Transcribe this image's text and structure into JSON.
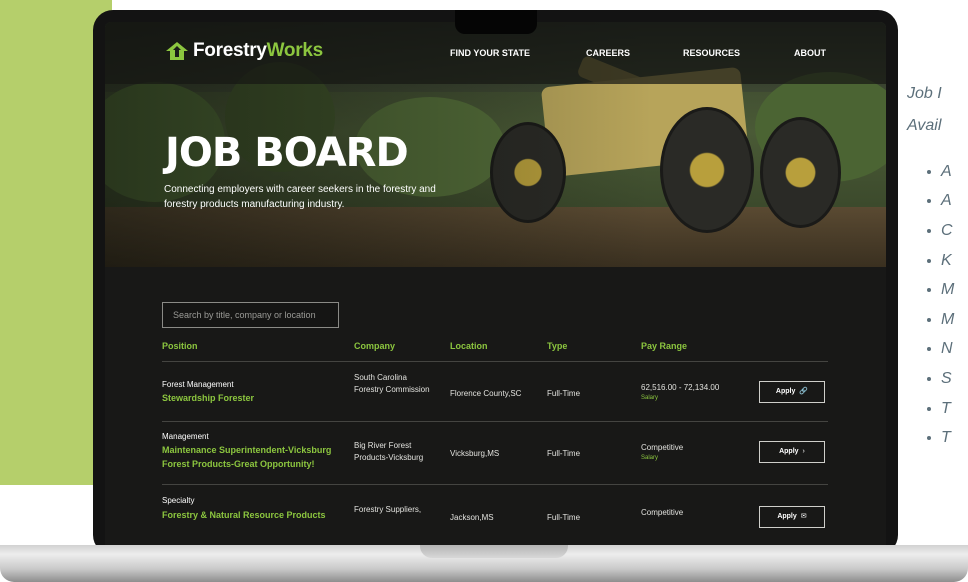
{
  "site": {
    "logo_part1": "Forestry",
    "logo_part2": "Works",
    "nav": [
      "FIND YOUR STATE",
      "CAREERS",
      "RESOURCES",
      "ABOUT"
    ]
  },
  "hero": {
    "title": "JOB BOARD",
    "subtitle": "Connecting employers with career seekers in the forestry and forestry products manufacturing industry."
  },
  "board": {
    "search_placeholder": "Search by title, company or location",
    "columns": [
      "Position",
      "Company",
      "Location",
      "Type",
      "Pay Range"
    ],
    "rows": [
      {
        "category": "Forest Management",
        "title": "Stewardship Forester",
        "company": "South Carolina Forestry Commission",
        "location": "Florence County,SC",
        "type": "Full-Time",
        "pay": "62,516.00 - 72,134.00",
        "pay_note": "Salary",
        "apply_label": "Apply",
        "apply_icon": "link-icon"
      },
      {
        "category": "Management",
        "title": "Maintenance Superintendent-Vicksburg Forest Products-Great Opportunity!",
        "company": "Big River Forest Products-Vicksburg",
        "location": "Vicksburg,MS",
        "type": "Full-Time",
        "pay": "Competitive",
        "pay_note": "Salary",
        "apply_label": "Apply",
        "apply_icon": "chevron-right-icon"
      },
      {
        "category": "Specialty",
        "title": "Forestry & Natural Resource Products",
        "company": "Forestry Suppliers,",
        "location": "Jackson,MS",
        "type": "Full-Time",
        "pay": "Competitive",
        "pay_note": "",
        "apply_label": "Apply",
        "apply_icon": "mail-icon"
      }
    ]
  },
  "side": {
    "heading_line1": "Job I",
    "heading_line2": "Avail",
    "items": [
      "A",
      "A",
      "C",
      "K",
      "M",
      "M",
      "N",
      "S",
      "T",
      "T"
    ]
  },
  "colors": {
    "accent_green": "#8cc63f",
    "panel_green": "#b5cf6b",
    "screen_bg": "#181817"
  }
}
